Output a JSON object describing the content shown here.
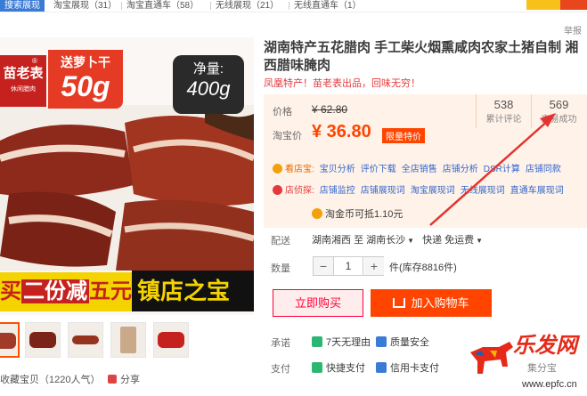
{
  "topbar": {
    "active_tab": "搜索展现",
    "tabs": [
      "淘宝展现（31）",
      "淘宝直通车（58）",
      "无线展现（21）",
      "无线直通车（1）"
    ]
  },
  "report_link": "举报",
  "product_image": {
    "brand": "苗老表",
    "brand_sub": "休闲腊肉",
    "brand_reg": "®",
    "gift_line1": "送萝卜干",
    "gift_line2": "50g",
    "netweight_label": "净量:",
    "netweight_value": "400g",
    "promo_left_a": "买",
    "promo_left_b": "二份减",
    "promo_left_c": "五元",
    "promo_right": "镇店之宝"
  },
  "favorites": "收藏宝贝（1220人气）",
  "share": "分享",
  "title": "湖南特产五花腊肉 手工柴火烟熏咸肉农家土猪自制 湘西腊味腌肉",
  "subtitle": "凤凰特产！苗老表出品，回味无穷！",
  "price": {
    "orig_label": "价格",
    "orig_value": "¥ 62.80",
    "promo_label": "淘宝价",
    "promo_value": "¥ 36.80",
    "promo_tag": "限量特价"
  },
  "stats": [
    {
      "num": "538",
      "label": "累计评论"
    },
    {
      "num": "569",
      "label": "交易成功"
    }
  ],
  "tools": [
    {
      "label": "看店宝:",
      "links": [
        "宝贝分析",
        "评价下载",
        "全店销售",
        "店铺分析",
        "DSR计算",
        "店铺同款"
      ]
    },
    {
      "label": "店侦探:",
      "links": [
        "店铺监控",
        "店铺展现词",
        "淘宝展现词",
        "无线展现词",
        "直通车展现词"
      ]
    }
  ],
  "coupon": "淘金币可抵1.10元",
  "shipping": {
    "label": "配送",
    "from": "湖南湘西",
    "to_word": "至",
    "to": "湖南长沙",
    "method": "快递 免运费"
  },
  "quantity": {
    "label": "数量",
    "minus": "−",
    "value": "1",
    "plus": "+",
    "stock": "件(库存8816件)"
  },
  "buttons": {
    "buy_now": "立即购买",
    "add_cart": "加入购物车"
  },
  "promise": {
    "label": "承诺",
    "items": [
      "7天无理由",
      "质量安全"
    ]
  },
  "payment": {
    "label": "支付",
    "items": [
      "快捷支付",
      "信用卡支付"
    ],
    "extra": "集分宝"
  },
  "watermark": {
    "text": "乐发网",
    "url": "www.epfc.cn"
  },
  "colors": {
    "accent": "#ff4400",
    "buy_border": "#ff0036",
    "price_bg": "#fff2e8",
    "link": "#3366cc",
    "arrow": "#e3342f"
  }
}
